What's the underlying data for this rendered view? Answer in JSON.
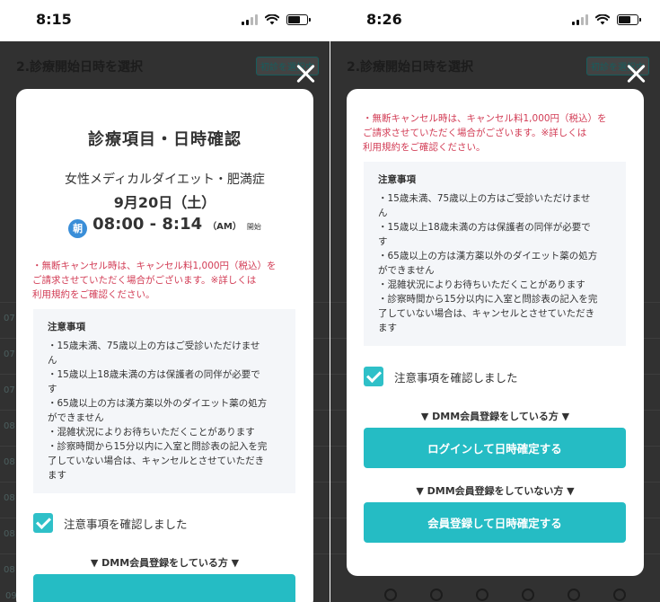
{
  "left": {
    "status": {
      "time": "8:15"
    },
    "background": {
      "title": "2.診療開始日時を選択",
      "chip": "初診を選択中",
      "row_times": [
        "07",
        "07",
        "07",
        "08",
        "08",
        "08",
        "08",
        "08",
        "09:15"
      ]
    },
    "modal": {
      "title": "診療項目・日時確認",
      "menu": "女性メディカルダイエット・肥満症",
      "date": "9月20日（土）",
      "period_badge": "朝",
      "time_range": "08:00 - 8:14",
      "am": "（AM）",
      "start_suffix": "開始"
    }
  },
  "right": {
    "status": {
      "time": "8:26"
    },
    "background": {
      "title": "2.診療開始日時を選択",
      "chip": "初診を選択中"
    }
  },
  "warning": {
    "lines": [
      "・無断キャンセル時は、キャンセル料1,000円（税込）を",
      "ご請求させていただく場合がございます。※詳しくは",
      "利用規約をご確認ください。"
    ]
  },
  "notes": {
    "heading": "注意事項",
    "lines": [
      "・15歳未満、75歳以上の方はご受診いただけませ",
      "ん",
      "・15歳以上18歳未満の方は保護者の同伴が必要で",
      "す",
      "・65歳以上の方は漢方薬以外のダイエット薬の処方",
      "ができません",
      "・混雑状況によりお待ちいただくことがあります",
      "・診察時間から15分以内に入室と問診表の記入を完",
      "了していない場合は、キャンセルとさせていただき",
      "ます"
    ]
  },
  "confirm": {
    "label": "注意事項を確認しました",
    "checked": true
  },
  "member_section": {
    "label": "▼ DMM会員登録をしている方 ▼",
    "button": "ログインして日時確定する"
  },
  "nonmember_section": {
    "label": "▼ DMM会員登録をしていない方 ▼",
    "button": "会員登録して日時確定する"
  },
  "colors": {
    "accent": "#25bcc4",
    "warning": "#d23c55",
    "morning_badge": "#3a8ed8"
  }
}
